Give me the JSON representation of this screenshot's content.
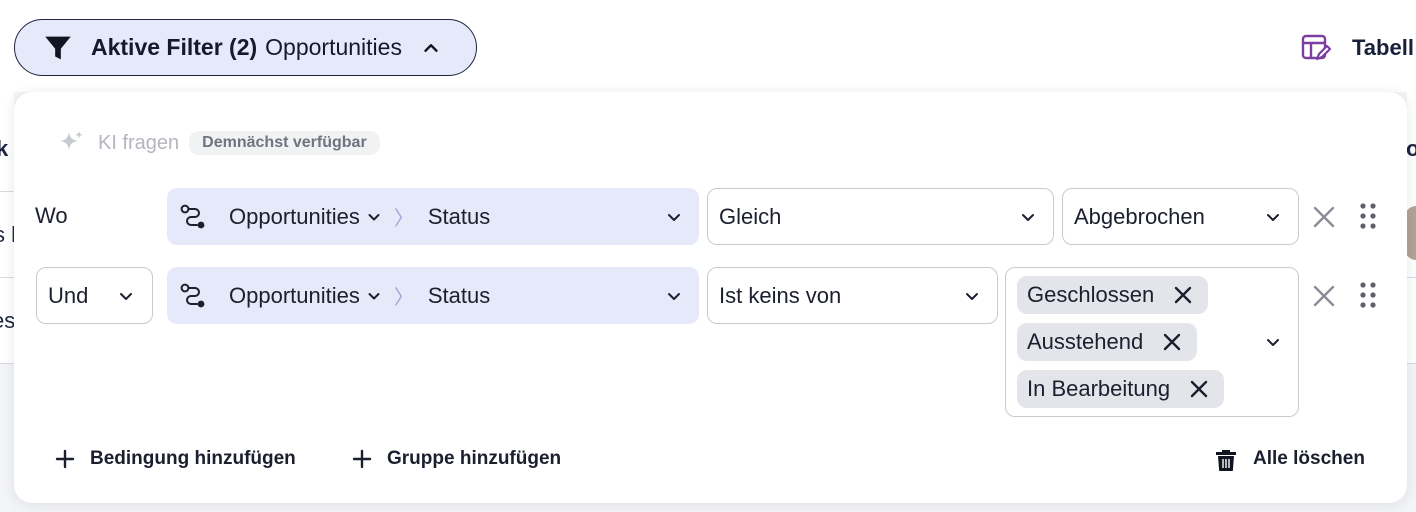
{
  "filter_pill": {
    "bold_label": "Aktive Filter (2)",
    "object_label": "Opportunities",
    "icons": {
      "filter": "funnel-icon",
      "toggle": "chevron-up-icon"
    }
  },
  "toolbar": {
    "table_label": "Tabell",
    "icons": {
      "table": "table-edit-icon"
    }
  },
  "background": {
    "header_fragment": "k",
    "right_header_fragment": "o",
    "row1_fragment": "s l",
    "row2_fragment": "es"
  },
  "ai": {
    "label": "KI fragen",
    "badge": "Demnächst verfügbar",
    "icon": "sparkle-icon"
  },
  "conditions": [
    {
      "connector": "Wo",
      "object": "Opportunities",
      "field": "Status",
      "operator": "Gleich",
      "value": "Abgebrochen"
    },
    {
      "connector": "Und",
      "object": "Opportunities",
      "field": "Status",
      "operator": "Ist keins von",
      "values": [
        "Geschlossen",
        "Ausstehend",
        "In Bearbeitung"
      ]
    }
  ],
  "footer": {
    "add_condition": "Bedingung hinzufügen",
    "add_group": "Gruppe hinzufügen",
    "clear_all": "Alle löschen"
  },
  "colors": {
    "accent_fill": "#e6e9fa",
    "table_icon": "#7b3fa0",
    "text_dark": "#1b1f2e"
  }
}
